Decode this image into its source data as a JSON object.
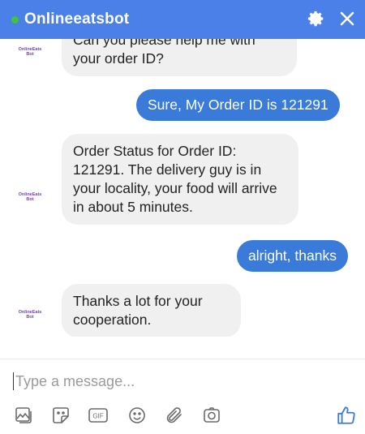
{
  "header": {
    "title": "Onlineeatsbot",
    "settings_icon": "gear-icon",
    "close_icon": "close-icon"
  },
  "bot": {
    "avatar_line1": "OnlineEats",
    "avatar_line2": "Bot"
  },
  "messages": [
    {
      "from": "bot",
      "text": "Can you please help me with your order ID?"
    },
    {
      "from": "user",
      "text": "Sure, My Order ID is 121291"
    },
    {
      "from": "bot",
      "text": "Order Status for Order ID: 121291. The delivery guy is in your locality, your food will arrive in about 5 minutes."
    },
    {
      "from": "user",
      "text": "alright, thanks"
    },
    {
      "from": "bot",
      "text": "Thanks a lot for your cooperation."
    }
  ],
  "composer": {
    "placeholder": "Type a message...",
    "tools": [
      "image-icon",
      "sticker-icon",
      "gif-icon",
      "emoji-icon",
      "attachment-icon",
      "camera-icon"
    ],
    "gif_label": "GIF",
    "like_icon": "thumbs-up-icon"
  },
  "colors": {
    "header": "#4a80e8",
    "user_bubble": "#3a7bd9",
    "bot_bubble": "#f0f0f0",
    "online": "#42c142",
    "like": "#3a7bd9"
  }
}
